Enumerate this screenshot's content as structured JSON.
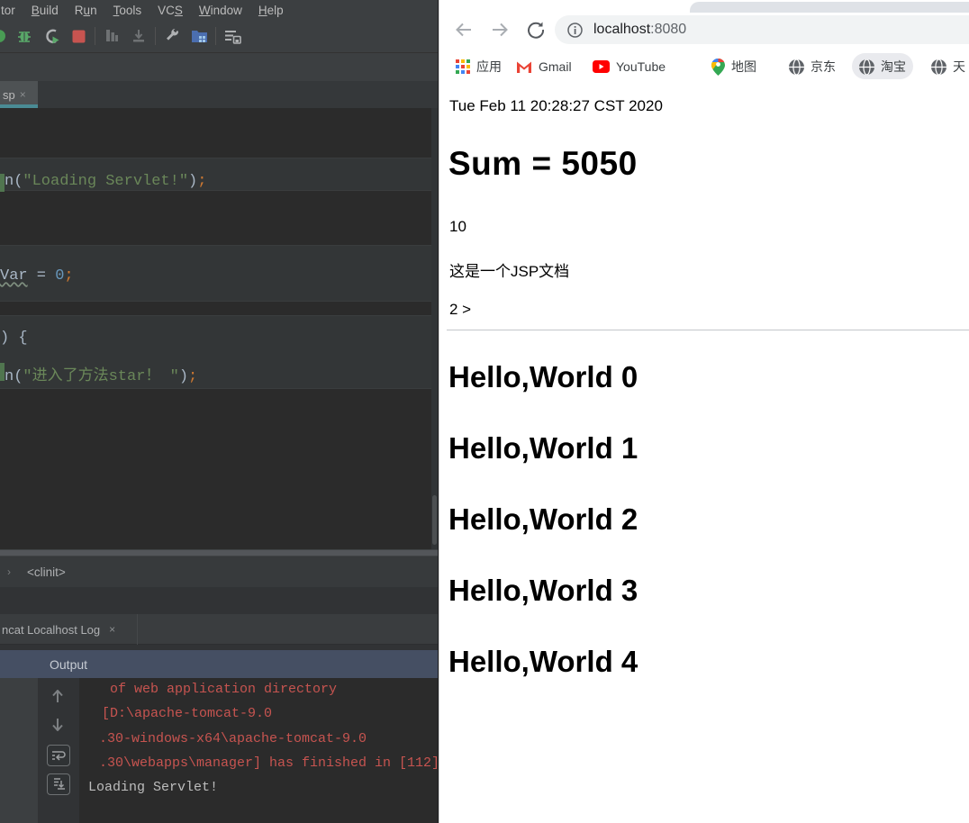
{
  "ide": {
    "menu": {
      "items": [
        {
          "label": "tor"
        },
        {
          "label": "Build"
        },
        {
          "label": "Run"
        },
        {
          "label": "Tools"
        },
        {
          "label": "VCS"
        },
        {
          "label": "Window"
        },
        {
          "label": "Help"
        }
      ]
    },
    "toolbar": {
      "icons": [
        "run-icon",
        "debug-icon",
        "run-with-coverage-icon",
        "stop-icon",
        "build-icon",
        "import-icon",
        "wrench-icon",
        "project-structure-icon",
        "update-application-icon"
      ]
    },
    "editor": {
      "tab": {
        "label": "sp",
        "close": "×"
      },
      "code_lines": [
        {
          "tokens": [
            {
              "text": "n(",
              "type": "plain"
            },
            {
              "text": "\"Loading Servlet!\"",
              "type": "string"
            },
            {
              "text": ")",
              "type": "plain"
            },
            {
              "text": ";",
              "type": "punct"
            }
          ]
        },
        {
          "tokens": [
            {
              "text": "Var",
              "type": "ident-warn"
            },
            {
              "text": " = ",
              "type": "plain"
            },
            {
              "text": "0",
              "type": "number"
            },
            {
              "text": ";",
              "type": "punct"
            }
          ]
        },
        {
          "tokens": [
            {
              "text": ") {",
              "type": "plain"
            }
          ]
        },
        {
          "tokens": [
            {
              "text": "n(",
              "type": "plain"
            },
            {
              "text": "\"进入了方法star！ \"",
              "type": "string"
            },
            {
              "text": ")",
              "type": "plain"
            },
            {
              "text": ";",
              "type": "punct"
            }
          ]
        }
      ]
    },
    "breadcrumb": {
      "chevron": "›",
      "label": "<clinit>"
    },
    "log_tab": {
      "label": "ncat Localhost Log",
      "close": "×"
    },
    "output": {
      "label": "Output"
    },
    "console": {
      "icons": [
        "up-arrow-icon",
        "down-arrow-icon",
        "soft-wrap-icon",
        "scroll-to-end-icon"
      ],
      "lines": [
        {
          "text": "of web application directory",
          "kind": "error"
        },
        {
          "text": "[D:\\apache-tomcat-9.0",
          "kind": "error"
        },
        {
          "text": ".30-windows-x64\\apache-tomcat-9.0",
          "kind": "error"
        },
        {
          "text": ".30\\webapps\\manager] has finished in [112]",
          "kind": "error"
        },
        {
          "text": "Loading Servlet!",
          "kind": "stdout"
        }
      ]
    }
  },
  "browser": {
    "colors": {
      "accent_teal": "#4a8b94",
      "error_red": "#c75450",
      "output_blue": "#454f63",
      "url_gray": "#f1f3f4"
    },
    "toolbar_icons": [
      "back-icon",
      "forward-icon",
      "reload-icon",
      "page-info-icon"
    ],
    "address": {
      "host": "localhost",
      "port": ":8080"
    },
    "bookmarks": [
      {
        "label": "应用",
        "icon": "apps-grid-icon"
      },
      {
        "label": "Gmail",
        "icon": "gmail-icon"
      },
      {
        "label": "YouTube",
        "icon": "youtube-icon"
      },
      {
        "label": "地图",
        "icon": "maps-icon"
      },
      {
        "label": "京东",
        "icon": "globe-icon"
      },
      {
        "label": "淘宝",
        "icon": "globe-icon",
        "highlighted": true
      },
      {
        "label": "天",
        "icon": "globe-icon"
      }
    ],
    "page": {
      "date_line": "Tue Feb 11 20:28:27 CST 2020",
      "sum_heading": "Sum = 5050",
      "value_line": "10",
      "jsp_line": "这是一个JSP文档",
      "count_line": "2 >",
      "hello_lines": [
        "Hello,World 0",
        "Hello,World 1",
        "Hello,World 2",
        "Hello,World 3",
        "Hello,World 4"
      ]
    }
  }
}
